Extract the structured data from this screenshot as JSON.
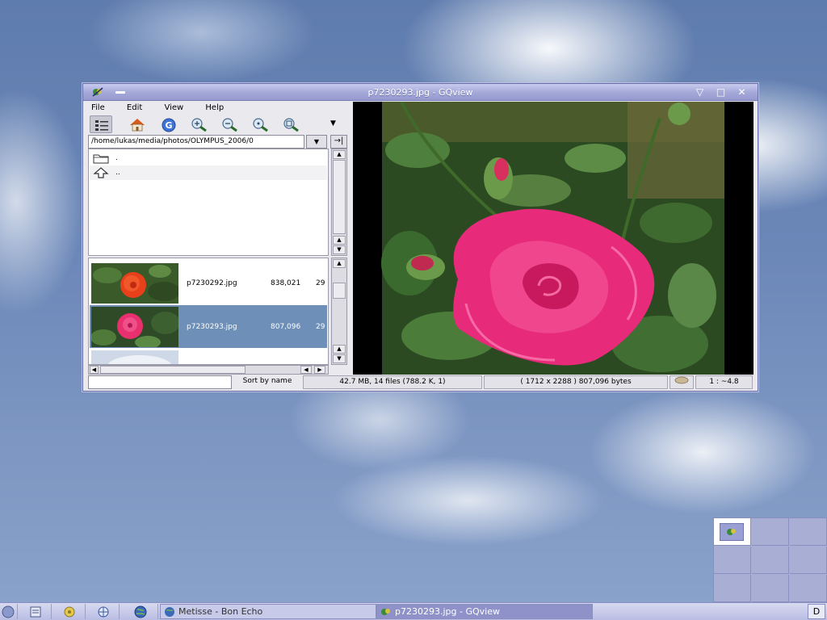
{
  "window": {
    "title": "p7230293.jpg - GQview",
    "menu": [
      "File",
      "Edit",
      "View",
      "Help"
    ],
    "path": "/home/lukas/media/photos/OLYMPUS_2006/0",
    "dir_entries": [
      ".",
      ".."
    ],
    "files": [
      {
        "name": "p7230292.jpg",
        "size": "838,021",
        "date": "29",
        "selected": false
      },
      {
        "name": "p7230293.jpg",
        "size": "807,096",
        "date": "29",
        "selected": true
      }
    ],
    "status": {
      "sort": "Sort by name",
      "summary": "42.7 MB, 14 files (788.2 K, 1)",
      "image_info": "( 1712 x 2288 ) 807,096 bytes",
      "zoom": "1 : ~4.8"
    }
  },
  "taskbar": {
    "tasks": [
      {
        "label": "Metisse - Bon Echo",
        "active": false
      },
      {
        "label": "p7230293.jpg - GQview",
        "active": true
      }
    ],
    "desktop_button": "D"
  },
  "colors": {
    "selection": "#6e8fb7",
    "titlebar": "#a6aad9",
    "taskbar": "#b9bde3"
  }
}
